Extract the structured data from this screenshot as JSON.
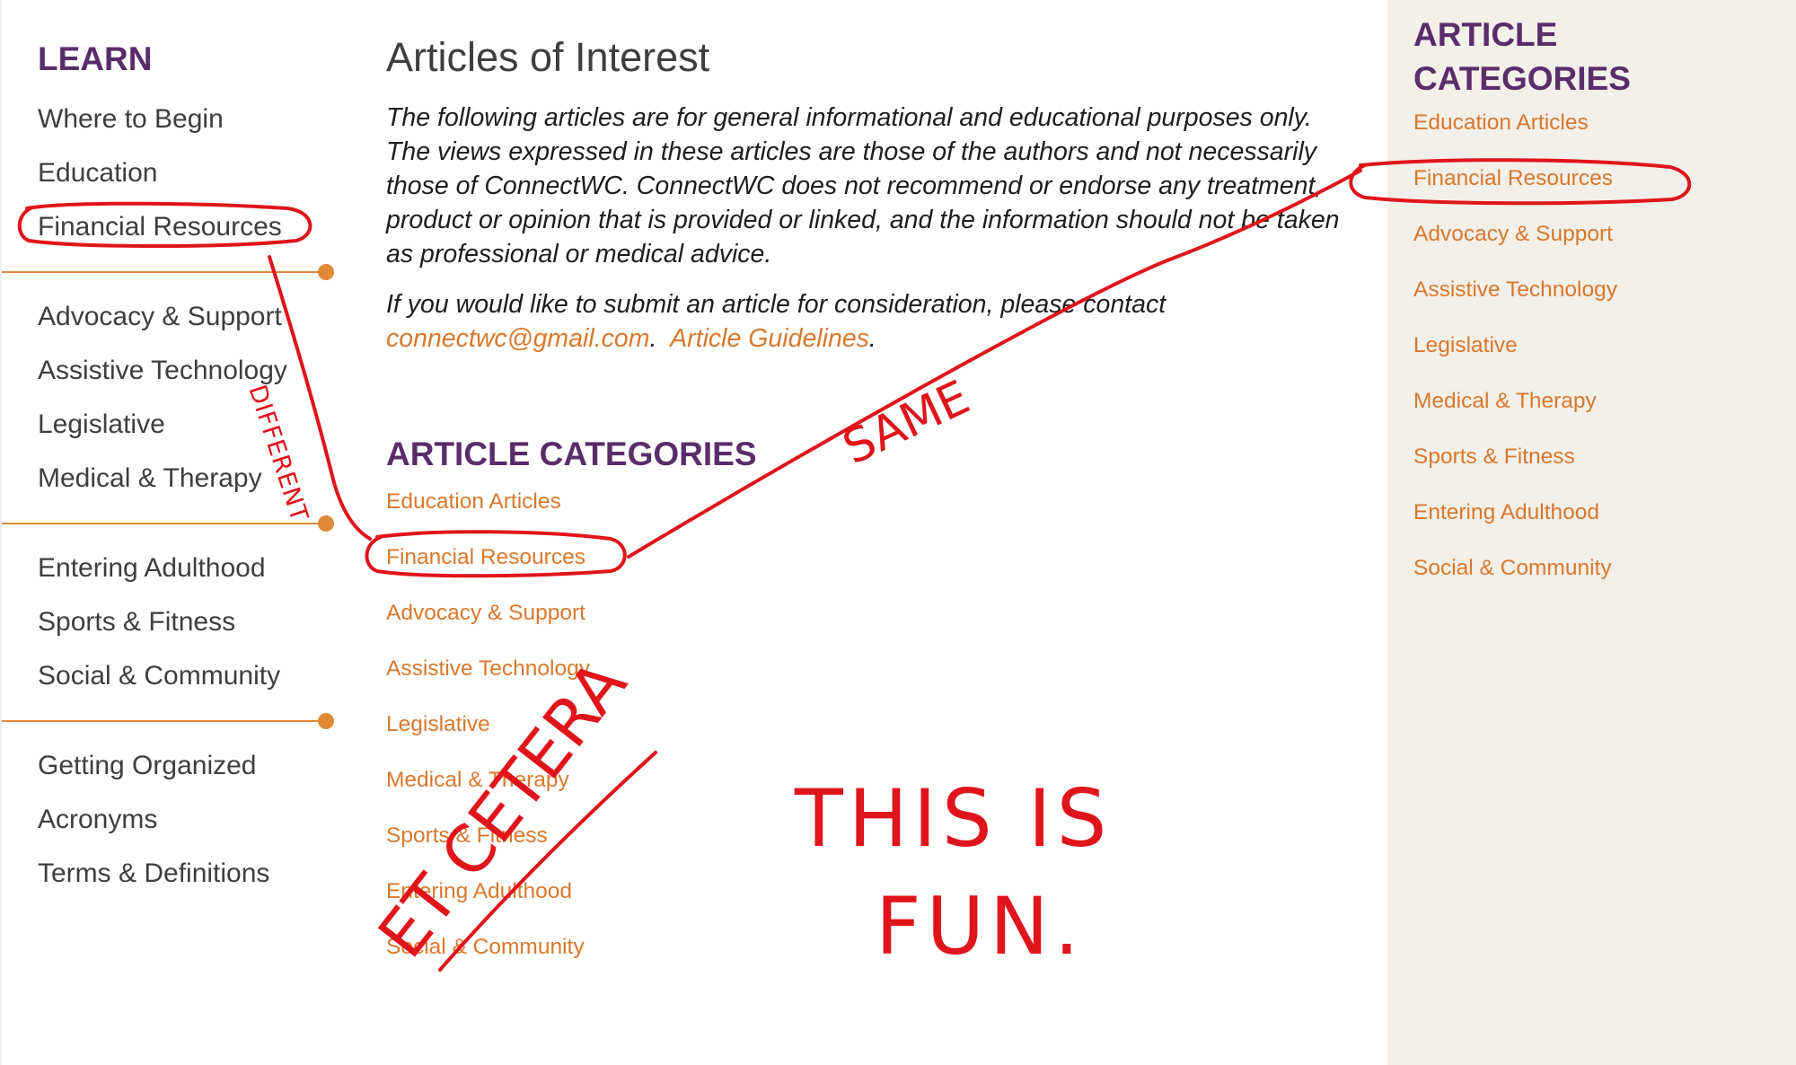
{
  "left_nav": {
    "heading": "LEARN",
    "items": [
      {
        "label": "Where to Begin"
      },
      {
        "label": "Education"
      },
      {
        "label": "Financial Resources"
      },
      {
        "label": "Advocacy & Support"
      },
      {
        "label": "Assistive Technology"
      },
      {
        "label": "Legislative"
      },
      {
        "label": "Medical & Therapy"
      },
      {
        "label": "Entering Adulthood"
      },
      {
        "label": "Sports & Fitness"
      },
      {
        "label": "Social & Community"
      },
      {
        "label": "Getting Organized"
      },
      {
        "label": "Acronyms"
      },
      {
        "label": "Terms & Definitions"
      }
    ]
  },
  "main": {
    "title": "Articles of Interest",
    "intro": "The following articles are for general informational and educational purposes only.  The views expressed in these articles are those of the authors and not necessarily those of ConnectWC.  ConnectWC does not recommend or endorse any treatment, product or opinion that is provided or linked, and the information should not be taken as professional or medical advice.",
    "submit_text": "If you would like to submit an article for consideration, please contact",
    "email_link": "connectwc@gmail.com",
    "separator": ".  ",
    "guidelines_link": "Article Guidelines",
    "end_period": ".",
    "categories_heading": "ARTICLE CATEGORIES",
    "categories": [
      "Education Articles",
      "Financial Resources",
      "Advocacy & Support",
      "Assistive Technology",
      "Legislative",
      "Medical & Therapy",
      "Sports & Fitness",
      "Entering Adulthood",
      "Social & Community"
    ]
  },
  "right_panel": {
    "heading_line1": "ARTICLE",
    "heading_line2": "CATEGORIES",
    "items": [
      "Education Articles",
      "Financial Resources",
      "Advocacy & Support",
      "Assistive Technology",
      "Legislative",
      "Medical & Therapy",
      "Sports & Fitness",
      "Entering Adulthood",
      "Social & Community"
    ]
  },
  "annotations": {
    "different": "DIFFERENT",
    "same": "SAME",
    "et_cetera": "ET CETERA",
    "fun_line1": "THIS IS",
    "fun_line2": "FUN.",
    "ink_color": "#e0141b"
  },
  "colors": {
    "heading_purple": "#5a2d6a",
    "link_orange": "#d9782c",
    "body_text": "#3e3e3e",
    "sidebar_bg": "#f3efe9"
  }
}
